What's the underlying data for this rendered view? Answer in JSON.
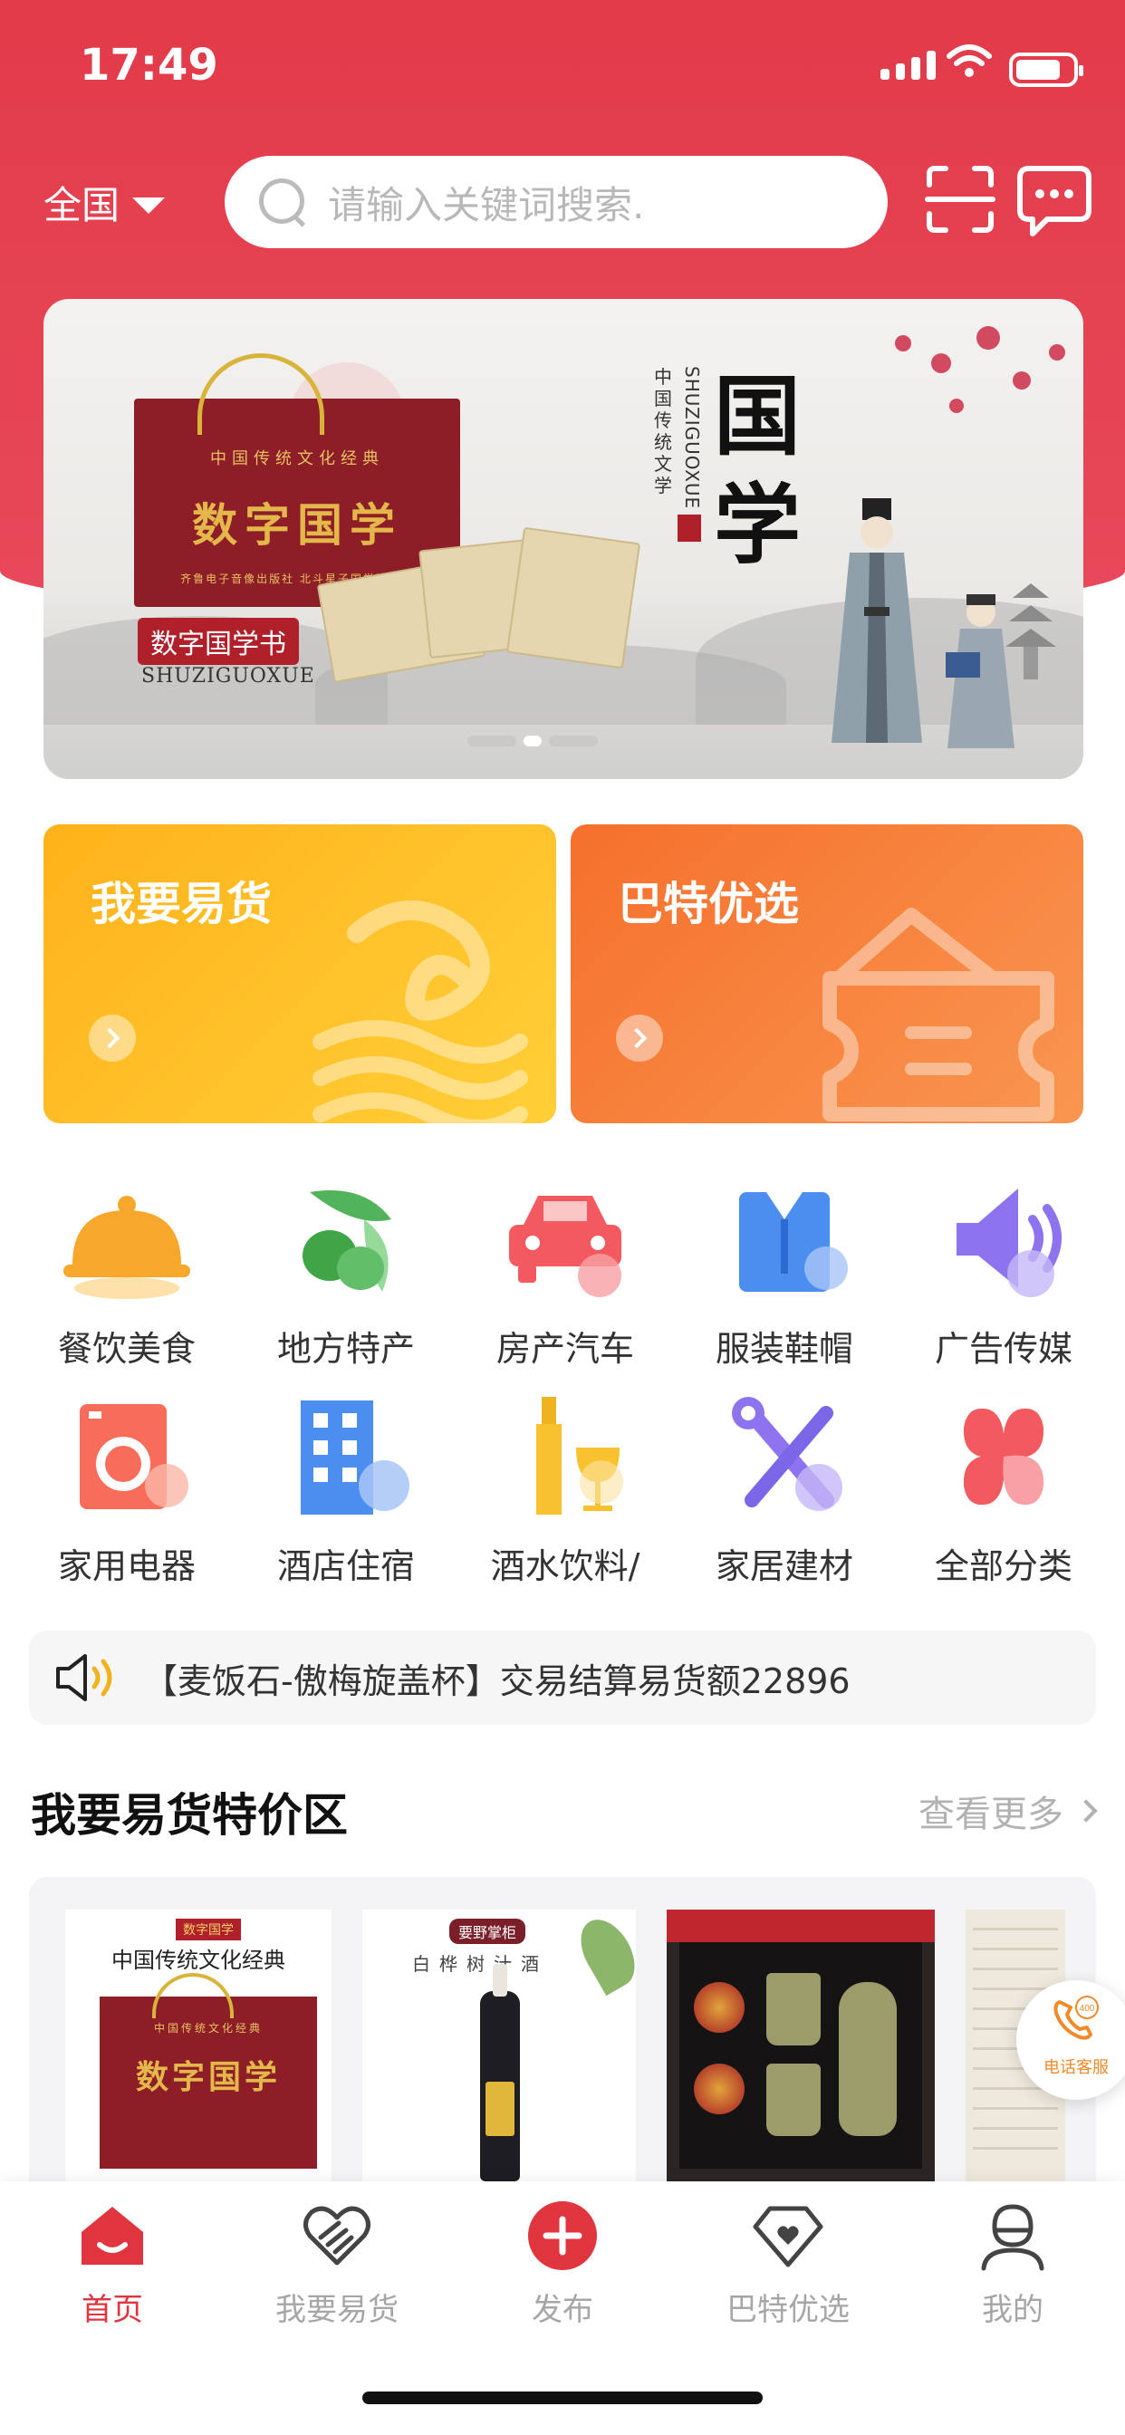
{
  "status_bar": {
    "time": "17:49",
    "battery_level": 0.8
  },
  "top_bar": {
    "region": "全国",
    "search_placeholder": "请输入关键词搜索.",
    "icons": [
      "scan-icon",
      "message-icon"
    ]
  },
  "banner": {
    "bag_subtitle": "中国传统文化经典",
    "bag_title": "数字国学",
    "bag_foot": "齐鲁电子音像出版社  北斗星子国学研究院",
    "tag": "数字国学书",
    "pinyin": "SHUZIGUOXUE",
    "big_title": "国学",
    "vertical_cn": "中国传统文学",
    "vertical_en": "SHUZIGUOXUE",
    "page_count": 3,
    "active_page": 1
  },
  "promos": [
    {
      "title": "我要易货",
      "color_from": "#ffb21a",
      "color_to": "#ffcf38"
    },
    {
      "title": "巴特优选",
      "color_from": "#f5702c",
      "color_to": "#f99650"
    }
  ],
  "categories": [
    {
      "label": "餐饮美食",
      "icon": "food-cloche-icon"
    },
    {
      "label": "地方特产",
      "icon": "olive-icon"
    },
    {
      "label": "房产汽车",
      "icon": "car-icon"
    },
    {
      "label": "服装鞋帽",
      "icon": "shirt-icon"
    },
    {
      "label": "广告传媒",
      "icon": "speaker-icon"
    },
    {
      "label": "家用电器",
      "icon": "washing-machine-icon"
    },
    {
      "label": "酒店住宿",
      "icon": "building-icon"
    },
    {
      "label": "酒水饮料/",
      "icon": "wine-icon"
    },
    {
      "label": "家居建材",
      "icon": "tools-icon"
    },
    {
      "label": "全部分类",
      "icon": "clover-icon"
    }
  ],
  "notice": {
    "text": "【麦饭石-傲梅旋盖杯】交易结算易货额22896"
  },
  "section": {
    "title": "我要易货特价区",
    "more": "查看更多"
  },
  "products": [
    {
      "tag": "数字国学",
      "head": "中国传统文化经典",
      "bag_title": "数字国学",
      "bag_sub": "中国传统文化经典"
    },
    {
      "tag": "要野掌柜",
      "sub": "白桦树汁酒"
    },
    {
      "desc": "tea-set"
    },
    {
      "desc": "scroll"
    }
  ],
  "service": {
    "badge": "400",
    "label": "电话客服"
  },
  "tabs": [
    {
      "label": "首页",
      "icon": "home-icon",
      "active": true
    },
    {
      "label": "我要易货",
      "icon": "handshake-heart-icon",
      "active": false
    },
    {
      "label": "发布",
      "icon": "plus-circle-icon",
      "active": false
    },
    {
      "label": "巴特优选",
      "icon": "diamond-heart-icon",
      "active": false
    },
    {
      "label": "我的",
      "icon": "user-icon",
      "active": false
    }
  ],
  "colors": {
    "brand_red": "#e23b4a",
    "active_tab": "#e0343e",
    "inactive_tab": "#a6a6a6"
  }
}
